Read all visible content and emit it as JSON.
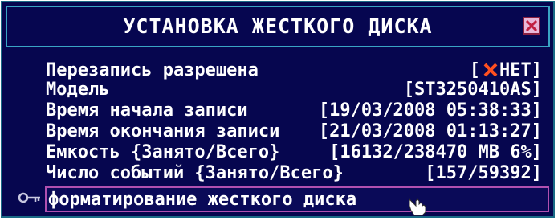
{
  "window": {
    "title": "УСТАНОВКА ЖЕСТКОГО ДИСКА",
    "close_icon": "close-x-icon"
  },
  "settings": [
    {
      "label": "Перезапись разрешена",
      "value_open": "[",
      "value_icon": "x-icon",
      "value": "НЕТ]"
    },
    {
      "label": "Модель",
      "value": "[ST3250410AS]"
    },
    {
      "label": "Время начала записи",
      "value": "[19/03/2008 05:38:33]"
    },
    {
      "label": "Время окончания записи",
      "value": "[21/03/2008 01:13:27]"
    },
    {
      "label": "Емкость {Занято/Всего}",
      "value": "[16132/238470 MB 6%]"
    },
    {
      "label": "Число событий {Занято/Всего}",
      "value": "[157/59392]"
    }
  ],
  "format": {
    "label": "форматирование жесткого диска",
    "icon": "key-icon"
  },
  "colors": {
    "background": "#06064f",
    "border": "#39a4c4",
    "highlight": "#b050b0",
    "x_mark": "#ff5020"
  }
}
